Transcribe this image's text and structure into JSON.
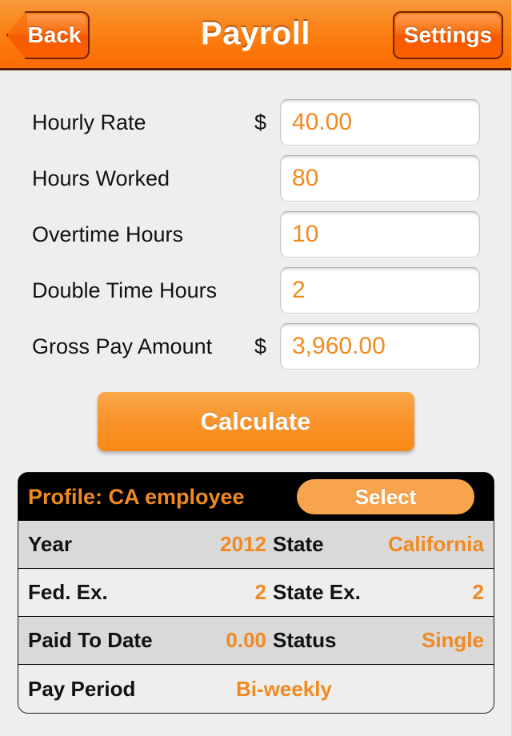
{
  "navbar": {
    "back_label": "Back",
    "title": "Payroll",
    "settings_label": "Settings"
  },
  "form": {
    "rows": [
      {
        "label": "Hourly Rate",
        "currency": "$",
        "value": "40.00"
      },
      {
        "label": "Hours Worked",
        "currency": "",
        "value": "80"
      },
      {
        "label": "Overtime Hours",
        "currency": "",
        "value": "10"
      },
      {
        "label": "Double Time Hours",
        "currency": "",
        "value": "2"
      },
      {
        "label": "Gross Pay Amount",
        "currency": "$",
        "value": "3,960.00"
      }
    ],
    "calculate_label": "Calculate"
  },
  "profile": {
    "title": "Profile: CA employee",
    "select_label": "Select",
    "rows": [
      {
        "label1": "Year",
        "value1": "2012",
        "label2": "State",
        "value2": "California"
      },
      {
        "label1": "Fed. Ex.",
        "value1": "2",
        "label2": "State Ex.",
        "value2": "2"
      },
      {
        "label1": "Paid To Date",
        "value1": "0.00",
        "label2": "Status",
        "value2": "Single"
      },
      {
        "label1": "Pay Period",
        "value1": "Bi-weekly",
        "label2": "",
        "value2": ""
      }
    ]
  },
  "colors": {
    "accent_orange": "#f08a20",
    "nav_orange": "#fa7e12",
    "panel_black": "#000000",
    "page_background": "#efeeee"
  }
}
